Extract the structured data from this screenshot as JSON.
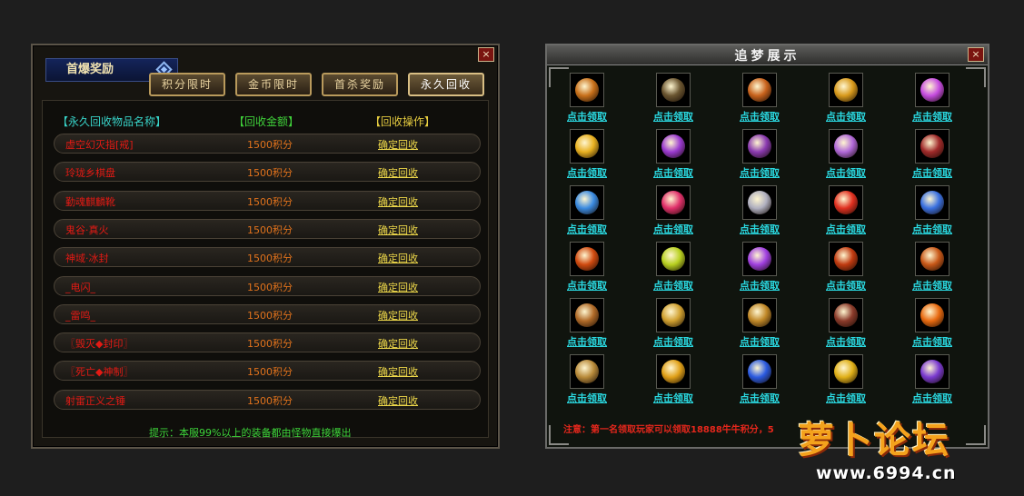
{
  "left_panel": {
    "title": "首爆奖励",
    "close_label": "×",
    "tabs": [
      {
        "label": "积分限时"
      },
      {
        "label": "金币限时"
      },
      {
        "label": "首杀奖励"
      },
      {
        "label": "永久回收"
      }
    ],
    "active_tab": 3,
    "columns": {
      "name": "【永久回收物品名称】",
      "amount": "【回收金额】",
      "action": "【回收操作】"
    },
    "rows": [
      {
        "name": "虚空幻灭指[戒]",
        "amount": "1500积分",
        "action": "确定回收"
      },
      {
        "name": "玲珑乡棋盘",
        "amount": "1500积分",
        "action": "确定回收"
      },
      {
        "name": "勤魂麒麟靴",
        "amount": "1500积分",
        "action": "确定回收"
      },
      {
        "name": "鬼谷·真火",
        "amount": "1500积分",
        "action": "确定回收"
      },
      {
        "name": "神域·冰封",
        "amount": "1500积分",
        "action": "确定回收"
      },
      {
        "name": "_电闪_",
        "amount": "1500积分",
        "action": "确定回收"
      },
      {
        "name": "_雷鸣_",
        "amount": "1500积分",
        "action": "确定回收"
      },
      {
        "name": "〖毁灭◆封印〗",
        "amount": "1500积分",
        "action": "确定回收"
      },
      {
        "name": "〖死亡◆神制〗",
        "amount": "1500积分",
        "action": "确定回收"
      },
      {
        "name": "射雷正义之锤",
        "amount": "1500积分",
        "action": "确定回收"
      }
    ],
    "tip": "提示：本服99%以上的装备都由怪物直接爆出"
  },
  "right_panel": {
    "title": "追梦展示",
    "close_label": "×",
    "claim_label": "点击领取",
    "items": [
      {
        "icon": "sun-emblem-icon",
        "color": "#c8701a"
      },
      {
        "icon": "plaque-icon",
        "color": "#6a5530"
      },
      {
        "icon": "bread-icon",
        "color": "#c8621c"
      },
      {
        "icon": "golden-gun-icon",
        "color": "#d89a1c"
      },
      {
        "icon": "violet-cube-icon",
        "color": "#c64ce0"
      },
      {
        "icon": "gold-feather-icon",
        "color": "#e8b020"
      },
      {
        "icon": "purple-orb-icon",
        "color": "#9a3ad0"
      },
      {
        "icon": "violet-crown-icon",
        "color": "#8a3ab0"
      },
      {
        "icon": "violet-ring-icon",
        "color": "#b068d8"
      },
      {
        "icon": "crimson-mask-icon",
        "color": "#a02a2a"
      },
      {
        "icon": "ice-crystal-icon",
        "color": "#3a8ae0"
      },
      {
        "icon": "ruby-flower-icon",
        "color": "#e0306a"
      },
      {
        "icon": "silver-shield-icon",
        "color": "#b0b0c0"
      },
      {
        "icon": "red-gem-icon",
        "color": "#e03020"
      },
      {
        "icon": "blue-shard-icon",
        "color": "#3a70e0"
      },
      {
        "icon": "fire-rune-icon",
        "color": "#d04a10"
      },
      {
        "icon": "lime-leaf-icon",
        "color": "#b8d020"
      },
      {
        "icon": "violet-sphere-icon",
        "color": "#a040e0"
      },
      {
        "icon": "lava-orb-icon",
        "color": "#c03a10"
      },
      {
        "icon": "ember-claw-icon",
        "color": "#c85818"
      },
      {
        "icon": "bronze-skull-icon",
        "color": "#b06a28"
      },
      {
        "icon": "gold-spiral-icon",
        "color": "#d0a030"
      },
      {
        "icon": "amber-ring-icon",
        "color": "#c08828"
      },
      {
        "icon": "dark-coil-icon",
        "color": "#8a3a2a"
      },
      {
        "icon": "orange-flame-icon",
        "color": "#e86a10"
      },
      {
        "icon": "golden-warrior-icon",
        "color": "#b88a3a"
      },
      {
        "icon": "gold-swirl-icon",
        "color": "#e0a018"
      },
      {
        "icon": "blue-orb-icon",
        "color": "#2a5ae0"
      },
      {
        "icon": "yellow-wing-icon",
        "color": "#e0b018"
      },
      {
        "icon": "violet-glow-icon",
        "color": "#7a3ad0"
      }
    ],
    "notice": "注意：第一名领取玩家可以领取18888牛牛积分，5"
  },
  "watermark": {
    "brand": "萝卜论坛",
    "url": "www.6994.cn"
  }
}
